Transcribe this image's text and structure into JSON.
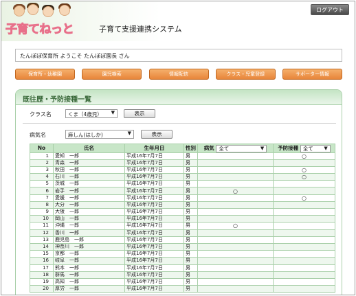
{
  "app": {
    "logo": "子育てねっと",
    "title": "子育て支援連携システム",
    "logout_label": "ログアウト"
  },
  "welcome": "たんぽぽ保育所 ようこそ たんぽぽ園長 さん",
  "menu": [
    "保育所・幼稚園",
    "園児検索",
    "情報配信",
    "クラス・児童登録",
    "サポーター情報"
  ],
  "panel": {
    "title": "既往歴・予防接種一覧",
    "class_label": "クラス名",
    "class_value": "くま（4歳児）",
    "disease_label": "病気名",
    "disease_value": "麻しん(はしか)",
    "show_label": "表示"
  },
  "table": {
    "headers": {
      "no": "No",
      "name": "氏名",
      "birth": "生年月日",
      "gender": "性別",
      "illness": "病気",
      "illness_filter": "全て",
      "vaccine": "予防接種",
      "vaccine_filter": "全て"
    },
    "rows": [
      {
        "no": "1",
        "name": "愛知　一郎",
        "birth": "平成16年7月7日",
        "gender": "男",
        "illness": "",
        "vaccine": "○"
      },
      {
        "no": "2",
        "name": "青森　一郎",
        "birth": "平成16年7月7日",
        "gender": "男",
        "illness": "",
        "vaccine": ""
      },
      {
        "no": "3",
        "name": "秋田　一郎",
        "birth": "平成16年7月7日",
        "gender": "男",
        "illness": "",
        "vaccine": "○"
      },
      {
        "no": "4",
        "name": "石川　一郎",
        "birth": "平成16年7月7日",
        "gender": "男",
        "illness": "",
        "vaccine": "○"
      },
      {
        "no": "5",
        "name": "茨城　一郎",
        "birth": "平成16年7月7日",
        "gender": "男",
        "illness": "",
        "vaccine": ""
      },
      {
        "no": "6",
        "name": "岩手　一郎",
        "birth": "平成16年7月7日",
        "gender": "男",
        "illness": "○",
        "vaccine": ""
      },
      {
        "no": "7",
        "name": "愛媛　一郎",
        "birth": "平成16年7月7日",
        "gender": "男",
        "illness": "",
        "vaccine": "○"
      },
      {
        "no": "8",
        "name": "大分　一郎",
        "birth": "平成16年7月7日",
        "gender": "男",
        "illness": "",
        "vaccine": ""
      },
      {
        "no": "9",
        "name": "大阪　一郎",
        "birth": "平成16年7月7日",
        "gender": "男",
        "illness": "",
        "vaccine": ""
      },
      {
        "no": "10",
        "name": "岡山　一郎",
        "birth": "平成16年7月7日",
        "gender": "男",
        "illness": "",
        "vaccine": ""
      },
      {
        "no": "11",
        "name": "沖縄　一郎",
        "birth": "平成16年7月7日",
        "gender": "男",
        "illness": "○",
        "vaccine": ""
      },
      {
        "no": "12",
        "name": "香川　一郎",
        "birth": "平成16年7月7日",
        "gender": "男",
        "illness": "",
        "vaccine": ""
      },
      {
        "no": "13",
        "name": "鹿児島　一郎",
        "birth": "平成16年7月7日",
        "gender": "男",
        "illness": "",
        "vaccine": ""
      },
      {
        "no": "14",
        "name": "神奈川　一郎",
        "birth": "平成16年7月7日",
        "gender": "男",
        "illness": "",
        "vaccine": ""
      },
      {
        "no": "15",
        "name": "京都　一郎",
        "birth": "平成16年7月7日",
        "gender": "男",
        "illness": "",
        "vaccine": ""
      },
      {
        "no": "16",
        "name": "岐阜　一郎",
        "birth": "平成16年7月7日",
        "gender": "男",
        "illness": "",
        "vaccine": ""
      },
      {
        "no": "17",
        "name": "熊本　一郎",
        "birth": "平成16年7月7日",
        "gender": "男",
        "illness": "",
        "vaccine": ""
      },
      {
        "no": "18",
        "name": "群馬　一郎",
        "birth": "平成16年7月7日",
        "gender": "男",
        "illness": "",
        "vaccine": ""
      },
      {
        "no": "19",
        "name": "高知　一郎",
        "birth": "平成16年7月7日",
        "gender": "男",
        "illness": "",
        "vaccine": ""
      },
      {
        "no": "20",
        "name": "厚労　一郎",
        "birth": "平成16年7月7日",
        "gender": "男",
        "illness": "",
        "vaccine": ""
      }
    ]
  },
  "colors": {
    "accent_green": "#c8e6c8",
    "menu_orange": "#e8853a",
    "logo_pink": "#e8708a"
  }
}
